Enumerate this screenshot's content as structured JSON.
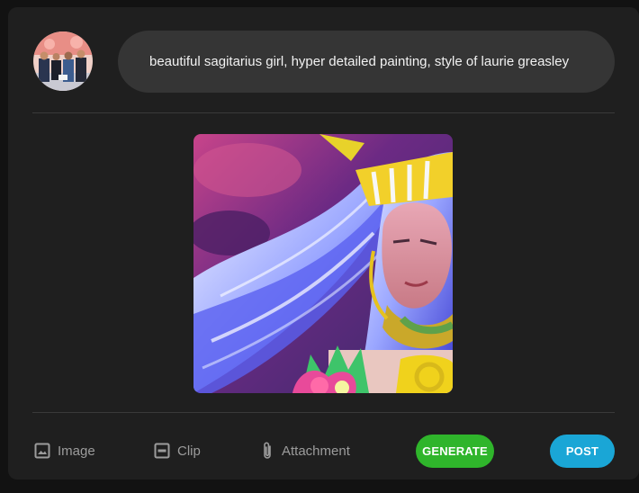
{
  "composer": {
    "prompt_value": "beautiful sagitarius girl, hyper detailed painting, style of laurie greasley"
  },
  "toolbar": {
    "image_label": "Image",
    "clip_label": "Clip",
    "attachment_label": "Attachment",
    "generate_label": "GENERATE",
    "post_label": "POST"
  },
  "icons": {
    "image": "image-icon",
    "clip": "gif-icon",
    "attachment": "paperclip-icon"
  },
  "colors": {
    "generate": "#2fb52b",
    "post": "#1aa6d6",
    "card": "#1f1f1f",
    "prompt_background": "#353535"
  }
}
